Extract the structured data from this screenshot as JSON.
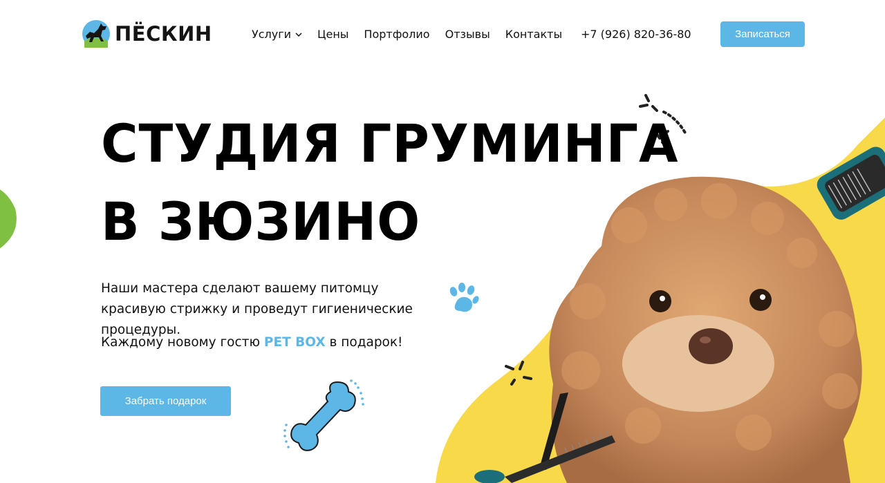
{
  "brand": {
    "name": "ПЁСКИН"
  },
  "nav": {
    "items": [
      {
        "label": "Услуги"
      },
      {
        "label": "Цены"
      },
      {
        "label": "Портфолио"
      },
      {
        "label": "Отзывы"
      },
      {
        "label": "Контакты"
      }
    ]
  },
  "header": {
    "phone": "+7 (926) 820-36-80",
    "cta_label": "Записаться"
  },
  "hero": {
    "title_line1": "СТУДИЯ ГРУМИНГА",
    "title_line2": "В ЗЮЗИНО",
    "lead": "Наши мастера сделают вашему питомцу красивую стрижку и проведут гигиенические процедуры.",
    "gift_prefix": "Каждому новому гостю ",
    "gift_highlight": "PET BOX",
    "gift_suffix": " в подарок!",
    "gift_button": "Забрать подарок"
  },
  "colors": {
    "accent": "#5db7e6",
    "yellow": "#f7d94a",
    "green": "#7fc043",
    "text": "#111111"
  },
  "icons": [
    "logo-dog-icon",
    "chevron-down-icon",
    "paw-icon",
    "bone-icon",
    "sparkle-icon",
    "scissors-icon",
    "brush-icon"
  ]
}
